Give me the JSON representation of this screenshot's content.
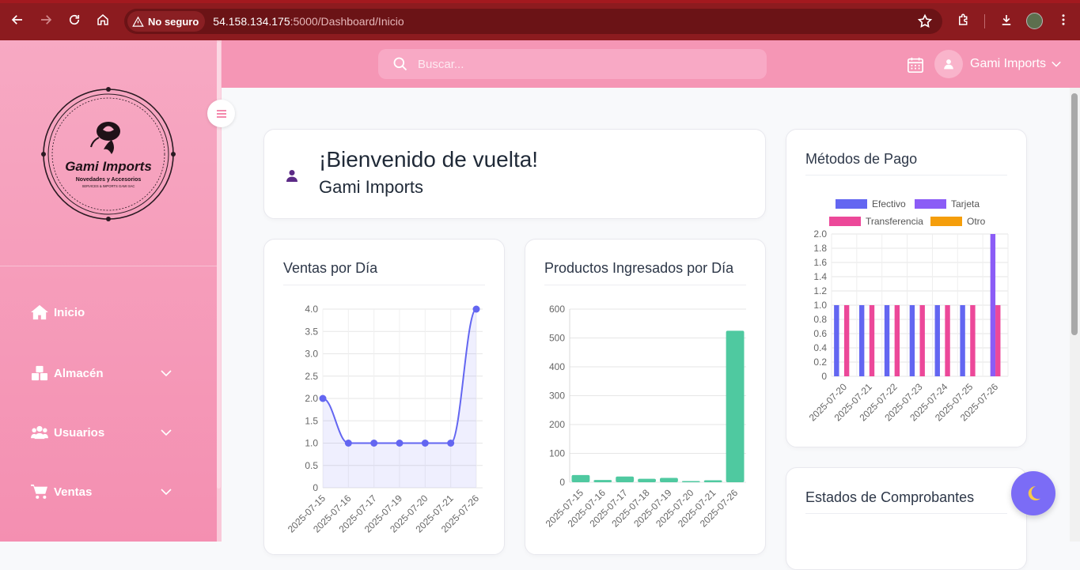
{
  "browser": {
    "security_label": "No seguro",
    "url_host": "54.158.134.175",
    "url_path": ":5000/Dashboard/Inicio"
  },
  "sidebar": {
    "logo": {
      "name": "Gami Imports",
      "tagline": "Novedades y Accesorios",
      "small": "SERVICES & IMPORTS GAMI SAC"
    },
    "items": [
      {
        "label": "Inicio",
        "icon": "home-icon",
        "expandable": false
      },
      {
        "label": "Almacén",
        "icon": "boxes-icon",
        "expandable": true
      },
      {
        "label": "Usuarios",
        "icon": "users-icon",
        "expandable": true
      },
      {
        "label": "Ventas",
        "icon": "cart-icon",
        "expandable": true
      }
    ]
  },
  "topbar": {
    "search_placeholder": "Buscar...",
    "user_name": "Gami Imports"
  },
  "welcome": {
    "title": "¡Bienvenido de vuelta!",
    "subtitle": "Gami Imports"
  },
  "cards": {
    "ventas_title": "Ventas por Día",
    "productos_title": "Productos Ingresados por Día",
    "metodos_title": "Métodos de Pago",
    "estados_title": "Estados de Comprobantes"
  },
  "colors": {
    "sidebar": "#f48fb1",
    "topbar": "#f596b5",
    "line": "#6366f1",
    "bar_green": "#4fc9a0",
    "efectivo": "#6366f1",
    "tarjeta": "#8b5cf6",
    "transferencia": "#ec4899",
    "otro": "#f59e0b",
    "theme_button": "#7b6cf6"
  },
  "chart_data": [
    {
      "type": "line",
      "title": "Ventas por Día",
      "x": [
        "2025-07-15",
        "2025-07-16",
        "2025-07-17",
        "2025-07-19",
        "2025-07-20",
        "2025-07-21",
        "2025-07-26"
      ],
      "values": [
        2,
        1,
        1,
        1,
        1,
        1,
        4
      ],
      "ylim": [
        0,
        4
      ],
      "yticks": [
        "0",
        "0.5",
        "1.0",
        "1.5",
        "2.0",
        "2.5",
        "3.0",
        "3.5",
        "4.0"
      ],
      "fill": true,
      "grid": true
    },
    {
      "type": "bar",
      "title": "Productos Ingresados por Día",
      "categories": [
        "2025-07-15",
        "2025-07-16",
        "2025-07-17",
        "2025-07-18",
        "2025-07-19",
        "2025-07-20",
        "2025-07-21",
        "2025-07-26"
      ],
      "values": [
        25,
        8,
        20,
        12,
        15,
        4,
        7,
        525
      ],
      "ylim": [
        0,
        600
      ],
      "yticks": [
        "0",
        "100",
        "200",
        "300",
        "400",
        "500",
        "600"
      ],
      "grid": true
    },
    {
      "type": "bar",
      "title": "Métodos de Pago",
      "categories": [
        "2025-07-20",
        "2025-07-21",
        "2025-07-22",
        "2025-07-23",
        "2025-07-24",
        "2025-07-25",
        "2025-07-26"
      ],
      "series": [
        {
          "name": "Efectivo",
          "values": [
            1,
            1,
            1,
            1,
            1,
            1,
            0
          ]
        },
        {
          "name": "Tarjeta",
          "values": [
            0,
            0,
            0,
            0,
            0,
            0,
            2
          ]
        },
        {
          "name": "Transferencia",
          "values": [
            1,
            1,
            1,
            1,
            1,
            1,
            1
          ]
        },
        {
          "name": "Otro",
          "values": [
            0,
            0,
            0,
            0,
            0,
            0,
            0
          ]
        }
      ],
      "ylim": [
        0,
        2
      ],
      "yticks": [
        "0",
        "0.2",
        "0.4",
        "0.6",
        "0.8",
        "1.0",
        "1.2",
        "1.4",
        "1.6",
        "1.8",
        "2.0"
      ],
      "legend": "top",
      "grid": true
    }
  ]
}
